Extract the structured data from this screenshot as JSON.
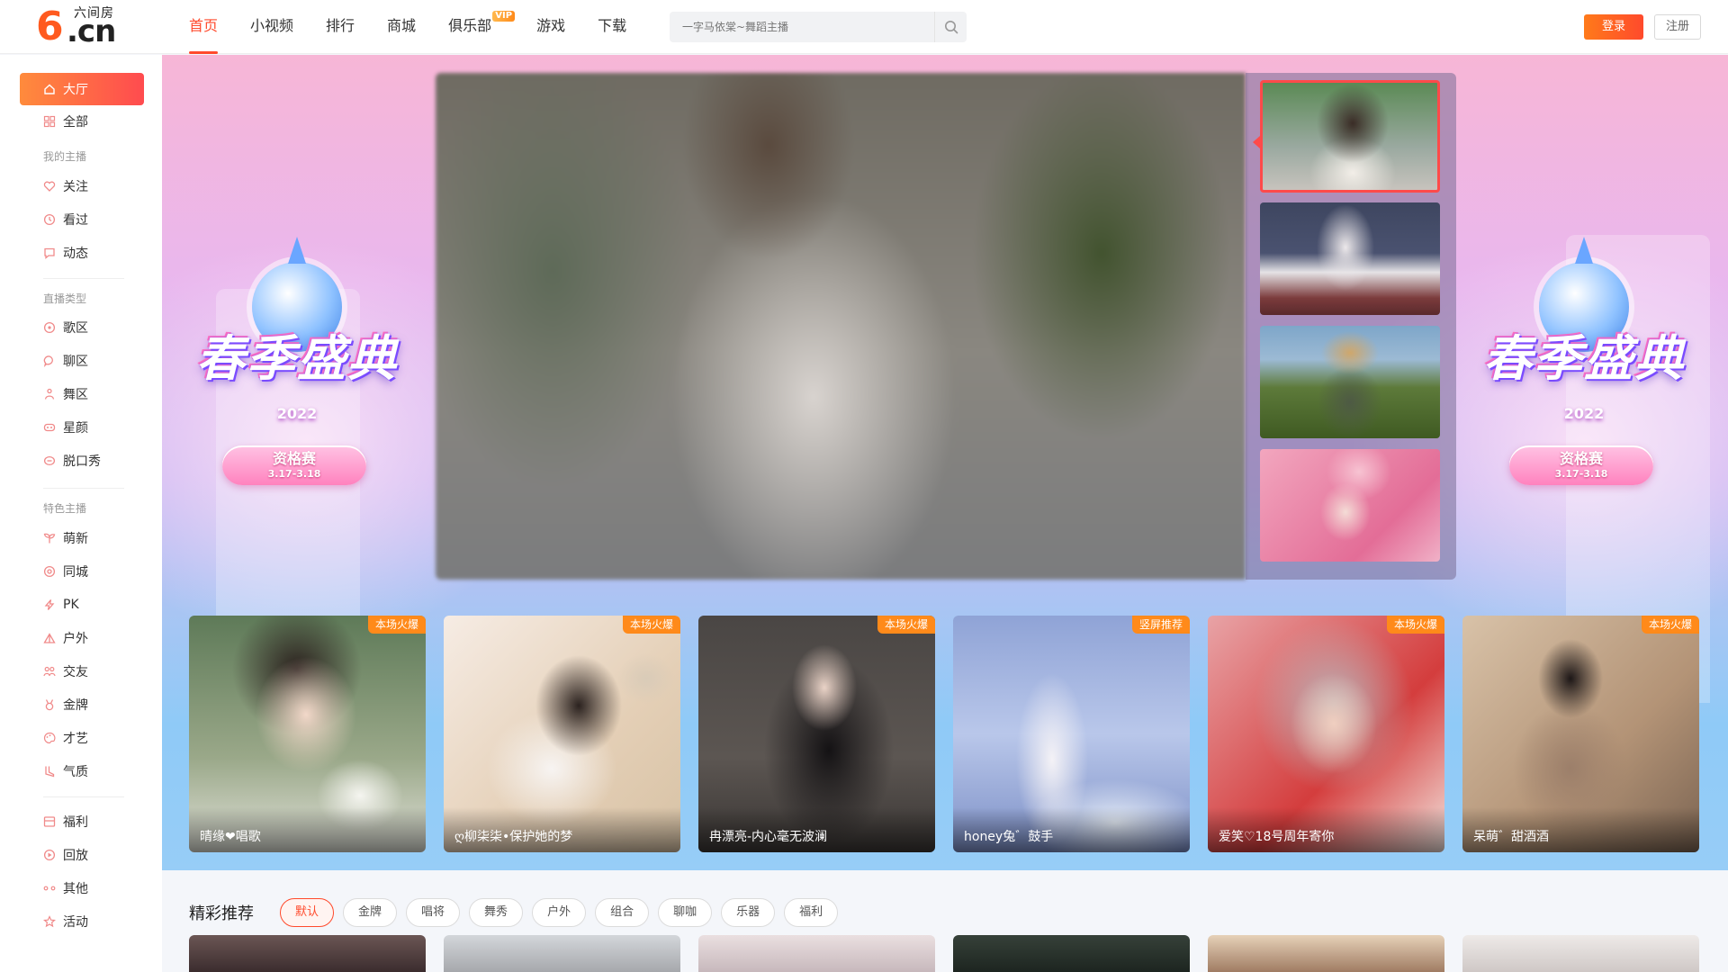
{
  "header": {
    "logo_mark": "6",
    "logo_text": ".cn",
    "logo_subtitle": "六间房",
    "nav": [
      {
        "label": "首页",
        "active": true
      },
      {
        "label": "小视频",
        "active": false
      },
      {
        "label": "排行",
        "active": false
      },
      {
        "label": "商城",
        "active": false
      },
      {
        "label": "俱乐部",
        "active": false,
        "badge": "VIP"
      },
      {
        "label": "游戏",
        "active": false
      },
      {
        "label": "下载",
        "active": false
      }
    ],
    "search_placeholder": "一字马依棠~舞蹈主播",
    "login_label": "登录",
    "register_label": "注册"
  },
  "sidebar": {
    "items": [
      {
        "label": "大厅",
        "icon": "home-icon",
        "active": true
      },
      {
        "label": "全部",
        "icon": "grid-icon"
      },
      {
        "label": "关注",
        "icon": "heart-icon"
      },
      {
        "label": "看过",
        "icon": "clock-icon"
      },
      {
        "label": "动态",
        "icon": "message-icon"
      },
      {
        "label": "歌区",
        "icon": "music-icon"
      },
      {
        "label": "聊区",
        "icon": "chat-icon"
      },
      {
        "label": "舞区",
        "icon": "dance-icon"
      },
      {
        "label": "星颜",
        "icon": "face-icon"
      },
      {
        "label": "脱口秀",
        "icon": "talk-icon"
      },
      {
        "label": "萌新",
        "icon": "sprout-icon"
      },
      {
        "label": "同城",
        "icon": "location-icon"
      },
      {
        "label": "PK",
        "icon": "lightning-icon"
      },
      {
        "label": "户外",
        "icon": "outdoor-icon"
      },
      {
        "label": "交友",
        "icon": "friends-icon"
      },
      {
        "label": "金牌",
        "icon": "medal-icon"
      },
      {
        "label": "才艺",
        "icon": "palette-icon"
      },
      {
        "label": "气质",
        "icon": "boot-icon"
      },
      {
        "label": "福利",
        "icon": "gift-icon"
      },
      {
        "label": "回放",
        "icon": "replay-icon"
      },
      {
        "label": "其他",
        "icon": "more-icon"
      },
      {
        "label": "活动",
        "icon": "star-icon"
      }
    ],
    "sections": {
      "my_anchors": "我的主播",
      "live_types": "直播类型",
      "featured": "特色主播"
    }
  },
  "hero": {
    "event_title": "春季盛典",
    "event_year": "2022",
    "event_stage": "资格赛",
    "event_dates": "3.17-3.18",
    "colors": {
      "accent": "#ff4a2c",
      "banner_top": "#f7b6d6",
      "banner_bottom": "#97cdf7"
    }
  },
  "hot_cards": [
    {
      "tag": "本场火爆",
      "name": "晴缘❤唱歌"
    },
    {
      "tag": "本场火爆",
      "name": "ღ柳柒柒•保护她的梦"
    },
    {
      "tag": "本场火爆",
      "name": "冉漂亮-内心毫无波澜"
    },
    {
      "tag": "竖屏推荐",
      "name": "honey兔゛鼓手"
    },
    {
      "tag": "本场火爆",
      "name": "爱笑♡18号周年寄你"
    },
    {
      "tag": "本场火爆",
      "name": "呆萌゛甜酒酒"
    }
  ],
  "recommend": {
    "title": "精彩推荐",
    "filters": [
      {
        "label": "默认",
        "active": true
      },
      {
        "label": "金牌"
      },
      {
        "label": "唱将"
      },
      {
        "label": "舞秀"
      },
      {
        "label": "户外"
      },
      {
        "label": "组合"
      },
      {
        "label": "聊咖"
      },
      {
        "label": "乐器"
      },
      {
        "label": "福利"
      }
    ]
  }
}
